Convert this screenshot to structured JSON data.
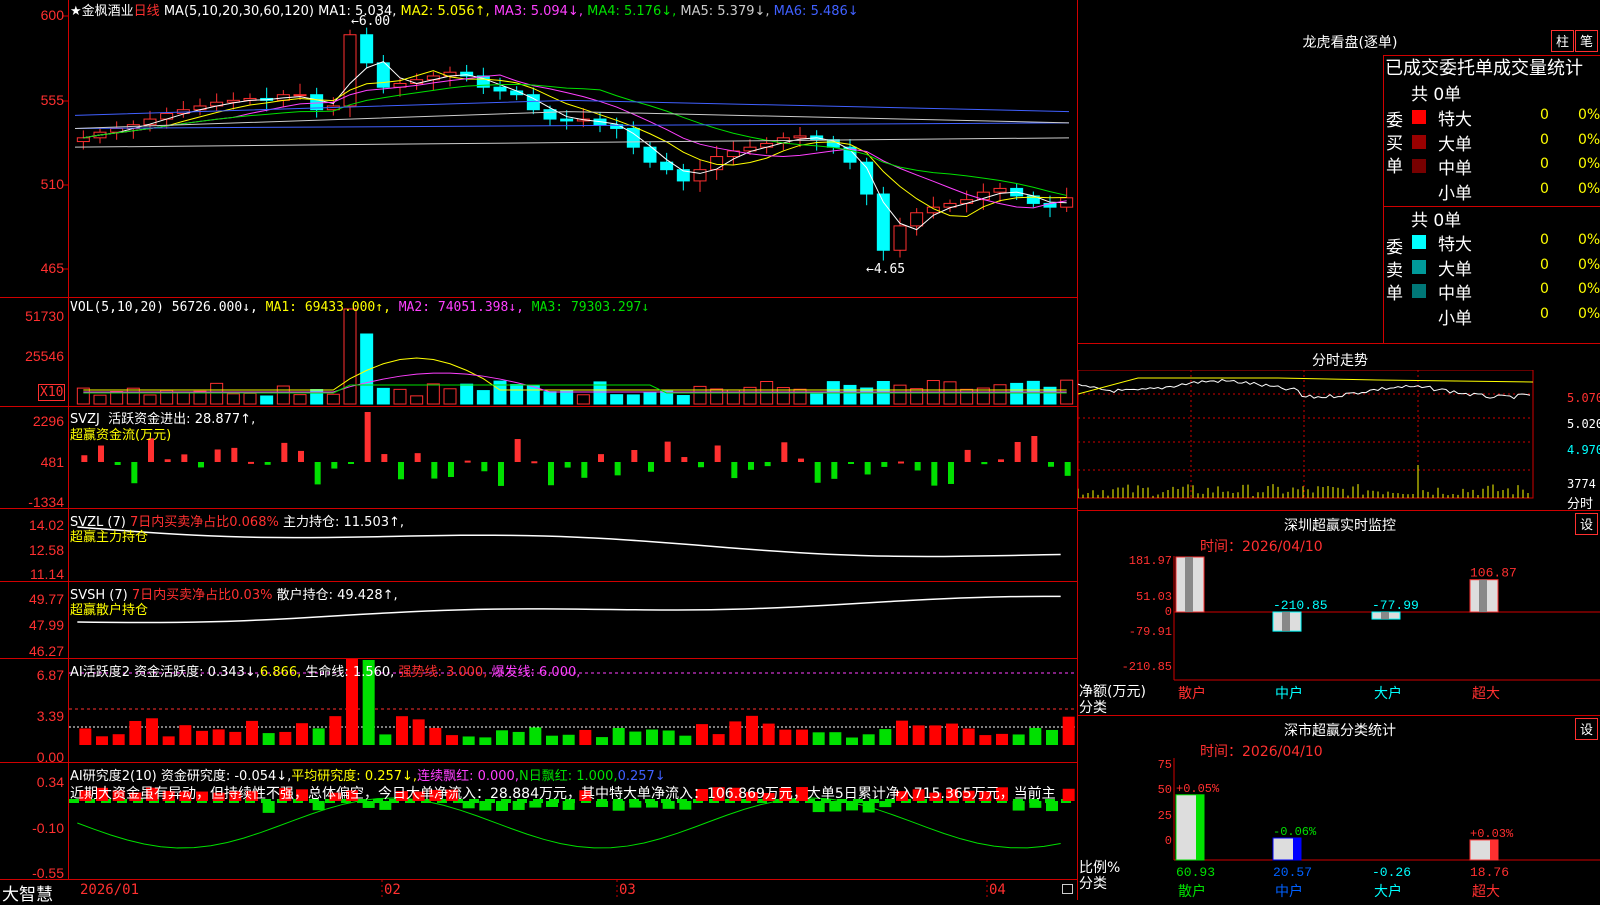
{
  "app": {
    "brand": "大智慧"
  },
  "main": {
    "star": "★",
    "stock_name": "金枫酒业",
    "period": "日线",
    "ma_def": "MA(5,10,20,30,60,120)",
    "ma": [
      {
        "label": "MA1:",
        "value": "5.034,",
        "color": "#ffffff"
      },
      {
        "label": "MA2:",
        "value": "5.056↑,",
        "color": "#ffff00"
      },
      {
        "label": "MA3:",
        "value": "5.094↓,",
        "color": "#ff40ff"
      },
      {
        "label": "MA4:",
        "value": "5.176↓,",
        "color": "#00e000"
      },
      {
        "label": "MA5:",
        "value": "5.379↓,",
        "color": "#cccccc"
      },
      {
        "label": "MA6:",
        "value": "5.486↓",
        "color": "#4060ff"
      }
    ],
    "y_labels": [
      "600",
      "555",
      "510",
      "465"
    ],
    "high_label": "6.00",
    "low_label": "4.65"
  },
  "vol": {
    "def": "VOL(5,10,20)",
    "value": "56726.000↓,",
    "ma": [
      {
        "label": "MA1:",
        "value": "69433.000↑,",
        "color": "#ffff00"
      },
      {
        "label": "MA2:",
        "value": "74051.398↓,",
        "color": "#ff40ff"
      },
      {
        "label": "MA3:",
        "value": "79303.297↓",
        "color": "#00e000"
      }
    ],
    "y_labels": [
      "51730",
      "25546"
    ],
    "unit": "X10"
  },
  "svzj": {
    "name": "SVZJ",
    "label": "活跃资金进出:",
    "value": "28.877↑,",
    "sub": "超赢资金流(万元)",
    "y_labels": [
      "2296",
      "481",
      "-1334"
    ]
  },
  "svzl": {
    "name": "SVZL (7)",
    "desc": "7日内买卖净占比0.068%",
    "label": "主力持仓:",
    "value": "11.503↑,",
    "sub": "超赢主力持仓",
    "y_labels": [
      "14.02",
      "12.58",
      "11.14"
    ]
  },
  "svsh": {
    "name": "SVSH (7)",
    "desc": "7日内买卖净占比0.03%",
    "label": "散户持仓:",
    "value": "49.428↑,",
    "sub": "超赢散户持仓",
    "y_labels": [
      "49.77",
      "47.99",
      "46.27"
    ]
  },
  "ai_act": {
    "name": "AI活跃度2",
    "label": "资金活跃度:",
    "value": "0.343↓,",
    "v2": "6.866,",
    "life_label": "生命线:",
    "life": "1.560,",
    "strong_label": "强势线:",
    "strong": "3.000,",
    "burst_label": "爆发线:",
    "burst": "6.000,",
    "y_labels": [
      "6.87",
      "3.39",
      "0.00"
    ]
  },
  "ai_res": {
    "name": "AI研究度2(10)",
    "label": "资金研究度:",
    "value": "-0.054↓,",
    "avg_label": "平均研究度:",
    "avg": "0.257↓,",
    "cont_label": "连续飘红:",
    "cont": "0.000,",
    "n_label": "N日飘红:",
    "n": "1.000,",
    "tail": "0.257↓",
    "text": "近期大资金虽有异动，但持续性不强，总体偏空，今日大单净流入：28.884万元，其中特大单净流入：106.869万元，大单5日累计净入715.365万元，当前主",
    "y_labels": [
      "0.34",
      "-0.10",
      "-0.55"
    ]
  },
  "x_axis": [
    "2026/01",
    "02",
    "03",
    "04"
  ],
  "right": {
    "lhb": {
      "title": "龙虎看盘(逐单)",
      "btn1": "柱",
      "btn2": "笔",
      "header": "已成交委托单成交量统计",
      "buy": {
        "side": "委买单",
        "total": "共 0单",
        "rows": [
          {
            "name": "特大",
            "n": "0",
            "pct": "0%",
            "color": "#ff0000"
          },
          {
            "name": "大单",
            "n": "0",
            "pct": "0%",
            "color": "#990000"
          },
          {
            "name": "中单",
            "n": "0",
            "pct": "0%",
            "color": "#770000"
          },
          {
            "name": "小单",
            "n": "0",
            "pct": "0%",
            "color": "#000000"
          }
        ]
      },
      "sell": {
        "side": "委卖单",
        "total": "共 0单",
        "rows": [
          {
            "name": "特大",
            "n": "0",
            "pct": "0%",
            "color": "#00ffff"
          },
          {
            "name": "大单",
            "n": "0",
            "pct": "0%",
            "color": "#009999"
          },
          {
            "name": "中单",
            "n": "0",
            "pct": "0%",
            "color": "#007777"
          },
          {
            "name": "小单",
            "n": "0",
            "pct": "0%",
            "color": "#000000"
          }
        ]
      }
    },
    "fenshi": {
      "title": "分时走势",
      "r_labels": [
        "5.070",
        "5.020",
        "4.970"
      ],
      "vol": "3774",
      "vol_unit": "分时"
    },
    "sz_monitor": {
      "title": "深圳超赢实时监控",
      "btn": "设",
      "time_label": "时间：",
      "time": "2026/04/10",
      "y_labels": [
        "181.97",
        "51.03",
        "0",
        "-79.91",
        "-210.85"
      ],
      "values": [
        {
          "label": "181.97",
          "value": 181.97
        },
        {
          "label": "-210.85",
          "value": -210.85
        },
        {
          "label": "-77.99",
          "value": -77.99
        },
        {
          "label": "106.87",
          "value": 106.87
        }
      ],
      "unit": "净额(万元)",
      "cat_label": "分类",
      "cats": [
        "散户",
        "中户",
        "大户",
        "超大"
      ]
    },
    "sz_class": {
      "title": "深市超赢分类统计",
      "btn": "设",
      "time_label": "时间：",
      "time": "2026/04/10",
      "y_labels": [
        "75",
        "50",
        "25",
        "0"
      ],
      "pct": [
        {
          "label": "+0.05%"
        },
        {
          "label": "-0.06%"
        },
        {
          "label": ""
        },
        {
          "label": "+0.03%"
        }
      ],
      "values": [
        {
          "label": "60.93",
          "value": 60.93
        },
        {
          "label": "20.57",
          "value": 20.57
        },
        {
          "label": "-0.26",
          "value": -0.26
        },
        {
          "label": "18.76",
          "value": 18.76
        }
      ],
      "unit": "比例%",
      "cat_label": "分类",
      "cats": [
        "散户",
        "中户",
        "大户",
        "超大"
      ]
    }
  },
  "colors": {
    "up": "#ff3030",
    "down": "#00ffff",
    "grid": "#ff0000",
    "bg": "#000000"
  }
}
